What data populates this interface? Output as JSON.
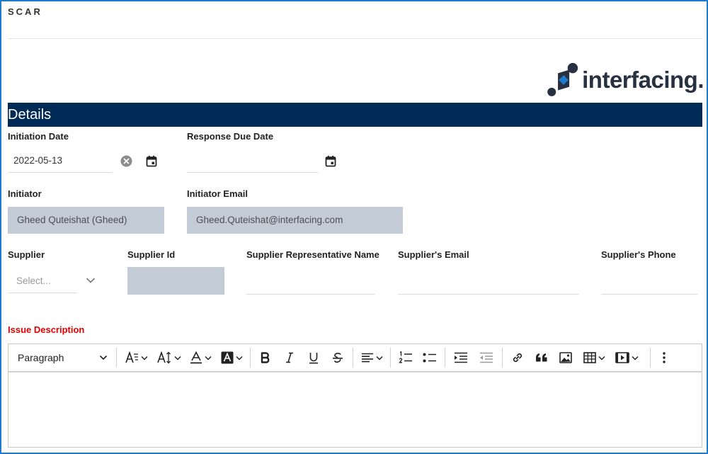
{
  "app": {
    "title": "SCAR"
  },
  "brand": {
    "logo_text": "interfacing.",
    "color": "#273142"
  },
  "section": {
    "title": "Details",
    "color": "#002b57"
  },
  "fields": {
    "initiation_date": {
      "label": "Initiation Date",
      "value": "2022-05-13"
    },
    "response_due_date": {
      "label": "Response Due Date",
      "value": ""
    },
    "initiator": {
      "label": "Initiator",
      "value": "Gheed Quteishat (Gheed)"
    },
    "initiator_email": {
      "label": "Initiator Email",
      "value": "Gheed.Quteishat@interfacing.com"
    },
    "supplier": {
      "label": "Supplier",
      "placeholder": "Select..."
    },
    "supplier_id": {
      "label": "Supplier Id",
      "value": ""
    },
    "supplier_rep_name": {
      "label": "Supplier Representative Name",
      "value": ""
    },
    "supplier_email": {
      "label": "Supplier's Email",
      "value": ""
    },
    "supplier_phone": {
      "label": "Supplier's Phone",
      "value": ""
    },
    "issue_description": {
      "label": "Issue Description",
      "required_color": "#e00000"
    }
  },
  "editor": {
    "block_format": "Paragraph",
    "tools": [
      "font-family",
      "font-size",
      "font-color",
      "highlight-color",
      "bold",
      "italic",
      "underline",
      "strikethrough",
      "alignment",
      "numbered-list",
      "bulleted-list",
      "indent",
      "outdent",
      "link",
      "block-quote",
      "insert-image",
      "insert-table",
      "insert-media",
      "more-options"
    ]
  }
}
